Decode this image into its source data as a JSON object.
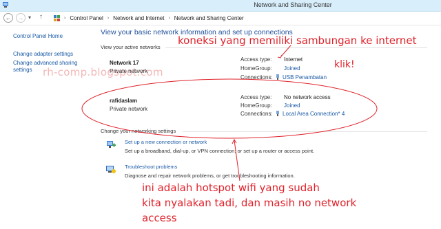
{
  "window": {
    "title": "Network and Sharing Center"
  },
  "nav": {
    "back_label": "←",
    "forward_label": "→",
    "recent_label": "▾",
    "up_label": "↑",
    "breadcrumb": [
      "Control Panel",
      "Network and Internet",
      "Network and Sharing Center"
    ],
    "separator": "›"
  },
  "sidebar": {
    "home": "Control Panel Home",
    "items": [
      "Change adapter settings",
      "Change advanced sharing settings"
    ]
  },
  "main": {
    "heading": "View your basic network information and set up connections",
    "active_networks_label": "View your active networks",
    "networks": [
      {
        "name": "Network  17",
        "type": "Private network",
        "access_type_label": "Access type:",
        "access_type": "Internet",
        "homegroup_label": "HomeGroup:",
        "homegroup": "Joined",
        "connections_label": "Connections:",
        "connection": "USB Penambatan"
      },
      {
        "name": "rafidaslam",
        "type": "Private network",
        "access_type_label": "Access type:",
        "access_type": "No network access",
        "homegroup_label": "HomeGroup:",
        "homegroup": "Joined",
        "connections_label": "Connections:",
        "connection": "Local Area Connection* 4"
      }
    ],
    "change_settings_label": "Change your networking settings",
    "tasks": [
      {
        "link": "Set up a new connection or network",
        "desc": "Set up a broadband, dial-up, or VPN connection; or set up a router or access point."
      },
      {
        "link": "Troubleshoot problems",
        "desc": "Diagnose and repair network problems, or get troubleshooting information."
      }
    ]
  },
  "annotations": {
    "top": "koneksi yang memiliki sambungan ke internet",
    "click": "klik!",
    "bottom_lines": [
      "ini adalah hotspot wifi yang sudah",
      "kita nyalakan tadi, dan masih no network",
      "access"
    ],
    "watermark": "rh-comp.blogspot.com",
    "color": "#e0222a"
  }
}
